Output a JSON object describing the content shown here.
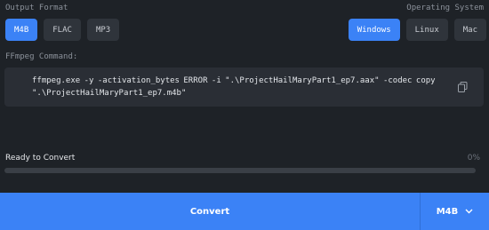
{
  "output_format": {
    "label": "Output Format",
    "options": [
      "M4B",
      "FLAC",
      "MP3"
    ],
    "selected": "M4B"
  },
  "operating_system": {
    "label": "Operating System",
    "options": [
      "Windows",
      "Linux",
      "Mac"
    ],
    "selected": "Windows"
  },
  "ffmpeg": {
    "label": "FFmpeg Command:",
    "command": "ffmpeg.exe -y -activation_bytes ERROR -i \".\\ProjectHailMaryPart1_ep7.aax\" -codec copy \".\\ProjectHailMaryPart1_ep7.m4b\"",
    "copy_icon": "copy-icon"
  },
  "status": {
    "label": "Ready to Convert",
    "progress_text": "0%",
    "progress_fraction": 0
  },
  "convert": {
    "label": "Convert",
    "format_value": "M4B",
    "dropdown_icon": "chevron-down-icon"
  },
  "colors": {
    "accent": "#3b82f6",
    "background": "#1e2227"
  }
}
